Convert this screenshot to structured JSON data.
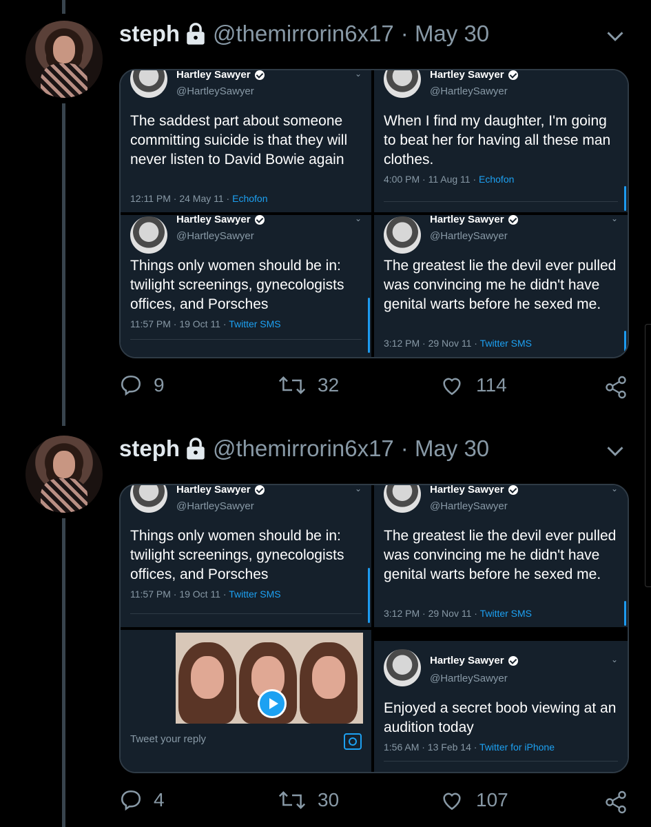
{
  "colors": {
    "background": "#000000",
    "card": "#15202b",
    "accent": "#1da1f2",
    "muted": "#8899a6",
    "divider": "#38444d"
  },
  "tweets": [
    {
      "name": "steph",
      "handle": "@themirrorin6x17",
      "date": "· May 30",
      "embeds": [
        {
          "name": "Hartley Sawyer",
          "handle": "@HartleySawyer",
          "text": "The saddest part about someone committing suicide is that they will never listen to David Bowie again",
          "time": "12:11 PM · 24 May 11 · ",
          "source": "Echofon"
        },
        {
          "name": "Hartley Sawyer",
          "handle": "@HartleySawyer",
          "text": "When I find my daughter, I'm going to beat her for having all these man clothes.",
          "time": "4:00 PM · 11 Aug 11 · ",
          "source": "Echofon"
        },
        {
          "name": "Hartley Sawyer",
          "handle": "@HartleySawyer",
          "text": "Things only women should be in: twilight screenings, gynecologists offices, and Porsches",
          "time": "11:57 PM · 19 Oct 11 · ",
          "source": "Twitter SMS"
        },
        {
          "name": "Hartley Sawyer",
          "handle": "@HartleySawyer",
          "text": "The greatest lie the devil ever pulled was convincing me he didn't have genital warts before he sexed me.",
          "time": "3:12 PM · 29 Nov 11 · ",
          "source": "Twitter SMS"
        }
      ],
      "stats": {
        "replies": "9",
        "retweets": "32",
        "likes": "114"
      }
    },
    {
      "name": "steph",
      "handle": "@themirrorin6x17",
      "date": "· May 30",
      "embeds": [
        {
          "name": "Hartley Sawyer",
          "handle": "@HartleySawyer",
          "text": "Things only women should be in: twilight screenings, gynecologists offices, and Porsches",
          "time": "11:57 PM · 19 Oct 11 · ",
          "source": "Twitter SMS"
        },
        {
          "name": "Hartley Sawyer",
          "handle": "@HartleySawyer",
          "text": "The greatest lie the devil ever pulled was convincing me he didn't have genital warts before he sexed me.",
          "time": "3:12 PM · 29 Nov 11 · ",
          "source": "Twitter SMS"
        },
        {
          "reply_placeholder": "Tweet your reply"
        },
        {
          "name": "Hartley Sawyer",
          "handle": "@HartleySawyer",
          "text": "Enjoyed a secret boob viewing at an audition today",
          "time": "1:56 AM · 13 Feb 14 · ",
          "source": "Twitter for iPhone"
        }
      ],
      "stats": {
        "replies": "4",
        "retweets": "30",
        "likes": "107"
      }
    }
  ]
}
